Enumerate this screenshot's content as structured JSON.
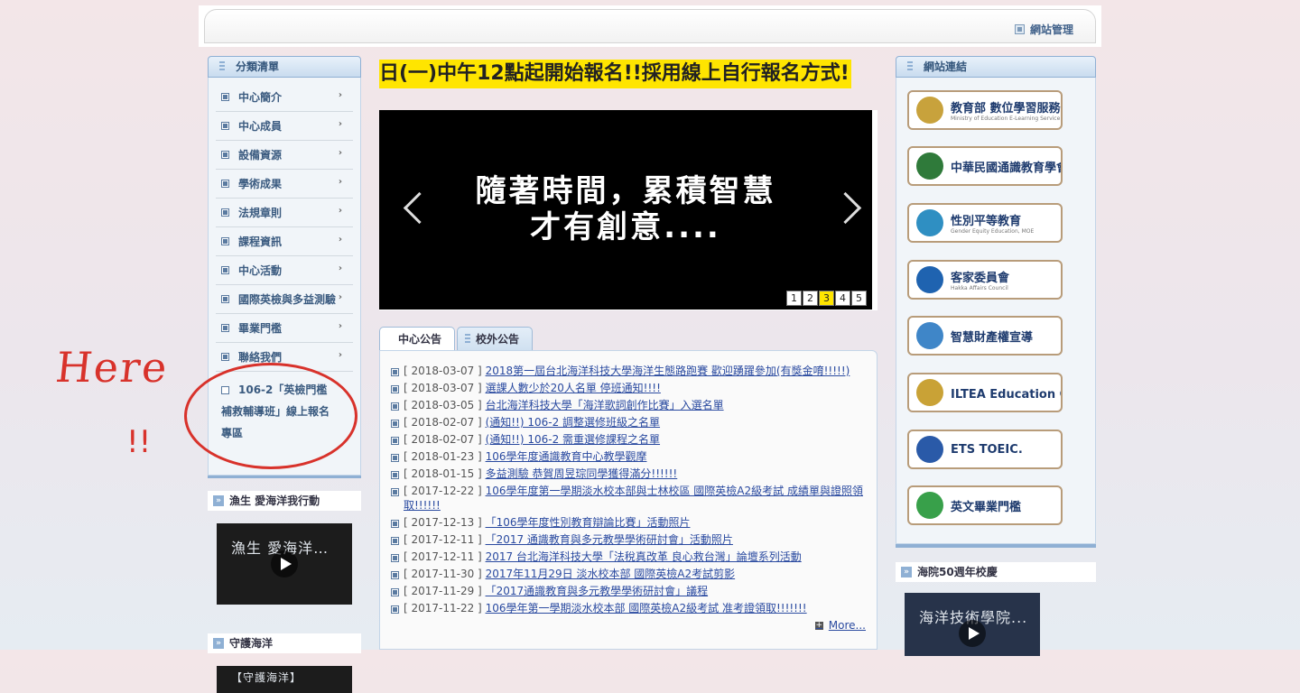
{
  "header": {
    "admin_label": "網站管理"
  },
  "left": {
    "menu_title": "分類清單",
    "menu_items": [
      "中心簡介",
      "中心成員",
      "設備資源",
      "學術成果",
      "法規章則",
      "課程資訊",
      "中心活動",
      "國際英檢與多益測驗",
      "畢業門檻",
      "聯絡我們"
    ],
    "promo_line1": "106-2「英檢門檻",
    "promo_line2": "補救輔導班」線上報名",
    "promo_line3": "專區",
    "section1_title": "漁生 愛海洋我行動",
    "video1_text": "漁生 愛海洋…",
    "section2_title": "守護海洋",
    "video2_text": "【守護海洋】"
  },
  "annotation": {
    "text": "Here",
    "mark": "!!"
  },
  "center": {
    "headline": "日(一)中午12點起開始報名!!採用線上自行報名方式!",
    "carousel_line1": "隨著時間，累積智慧",
    "carousel_line2": "才有創意....",
    "pager": [
      "1",
      "2",
      "3",
      "4",
      "5"
    ],
    "pager_active": "3",
    "tabs": [
      "中心公告",
      "校外公告"
    ],
    "news": [
      {
        "date": "[ 2018-03-07 ]",
        "title": "2018第一屆台北海洋科技大學海洋生態路跑賽 歡迎踴躍參加(有獎金唷!!!!!)"
      },
      {
        "date": "[ 2018-03-07 ]",
        "title": "選課人數少於20人名單 停班通知!!!!"
      },
      {
        "date": "[ 2018-03-05 ]",
        "title": "台北海洋科技大學「海洋歌詞創作比賽」入選名單"
      },
      {
        "date": "[ 2018-02-07 ]",
        "title": "(通知!!) 106-2 調整選修班級之名單"
      },
      {
        "date": "[ 2018-02-07 ]",
        "title": "(通知!!) 106-2 需重選修課程之名單"
      },
      {
        "date": "[ 2018-01-23 ]",
        "title": "106學年度通識教育中心教學觀摩"
      },
      {
        "date": "[ 2018-01-15 ]",
        "title": "多益測驗 恭賀周昱琮同學獲得滿分!!!!!!"
      },
      {
        "date": "[ 2017-12-22 ]",
        "title": "106學年度第一學期淡水校本部與士林校區 國際英檢A2級考試 成績單與證照領取!!!!!!"
      },
      {
        "date": "[ 2017-12-13 ]",
        "title": "「106學年度性別教育辯論比賽」活動照片"
      },
      {
        "date": "[ 2017-12-11 ]",
        "title": "「2017 通識教育與多元教學學術研討會」活動照片"
      },
      {
        "date": "[ 2017-12-11 ]",
        "title": "2017 台北海洋科技大學「法稅真改革 良心救台灣」論壇系列活動"
      },
      {
        "date": "[ 2017-11-30 ]",
        "title": "2017年11月29日 淡水校本部 國際英檢A2考試剪影"
      },
      {
        "date": "[ 2017-11-29 ]",
        "title": "「2017通識教育與多元教學學術研討會」議程"
      },
      {
        "date": "[ 2017-11-22 ]",
        "title": "106學年第一學期淡水校本部 國際英檢A2級考試 准考證領取!!!!!!!"
      }
    ],
    "more_label": "More..."
  },
  "right": {
    "links_title": "網站連結",
    "links": [
      {
        "label": "教育部 數位學習服務平台",
        "sub": "Ministry of Education  E-Learning Service Center",
        "icon": "moe-icon",
        "color": "#c8a23c"
      },
      {
        "label": "中華民國通識教育學會",
        "sub": "",
        "icon": "general-education-icon",
        "color": "#2f7a3a"
      },
      {
        "label": "性別平等教育",
        "sub": "Gender Equity Education, MOE",
        "icon": "gender-equity-icon",
        "color": "#2f8fc2"
      },
      {
        "label": "客家委員會",
        "sub": "Hakka Affairs Council",
        "icon": "hakka-icon",
        "color": "#1f63b0"
      },
      {
        "label": "智慧財產權宣導",
        "sub": "",
        "icon": "ip-head-icon",
        "color": "#3f86c8"
      },
      {
        "label": "ILTEA Education Group 國際英檢",
        "sub": "",
        "icon": "iltea-icon",
        "color": "#c9a236"
      },
      {
        "label": "ETS TOEIC.",
        "sub": "",
        "icon": "ets-icon",
        "color": "#2a5aa8"
      },
      {
        "label": "英文畢業門檻",
        "sub": "",
        "icon": "tumt-icon",
        "color": "#38a04a"
      }
    ],
    "section_title": "海院50週年校慶",
    "video_text": "海洋技術學院..."
  }
}
